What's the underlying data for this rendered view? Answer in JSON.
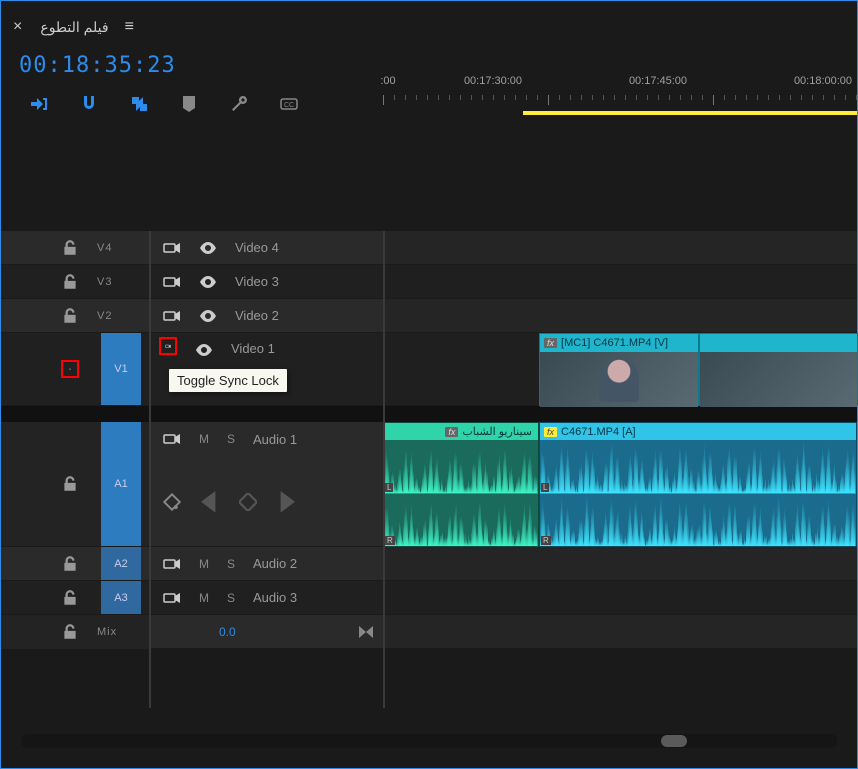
{
  "header": {
    "close": "×",
    "title": "فيلم التطوع",
    "menu": "≡"
  },
  "timecode": "00:18:35:23",
  "ruler": {
    "labels": [
      {
        "pos": 0,
        "text": ":00"
      },
      {
        "pos": 110,
        "text": "00:17:30:00"
      },
      {
        "pos": 275,
        "text": "00:17:45:00"
      },
      {
        "pos": 440,
        "text": "00:18:00:00"
      }
    ]
  },
  "tooltip": "Toggle Sync Lock",
  "tracks": {
    "video": [
      {
        "id": "V4",
        "name": "Video 4"
      },
      {
        "id": "V3",
        "name": "Video 3"
      },
      {
        "id": "V2",
        "name": "Video 2"
      },
      {
        "id": "V1",
        "name": "Video 1"
      }
    ],
    "audio": [
      {
        "id": "A1",
        "name": "Audio 1",
        "mute": "M",
        "solo": "S"
      },
      {
        "id": "A2",
        "name": "Audio 2",
        "mute": "M",
        "solo": "S"
      },
      {
        "id": "A3",
        "name": "Audio 3",
        "mute": "M",
        "solo": "S"
      }
    ],
    "mix": {
      "label": "Mix",
      "value": "0.0"
    }
  },
  "clips": {
    "v1": {
      "fx": "fx",
      "name": "[MC1] C4671.MP4 [V]"
    },
    "a1_left": {
      "fx": "fx",
      "name": "سيناريو الشباب",
      "chL": "L",
      "chR": "R"
    },
    "a1_right": {
      "fx": "fx",
      "name": "C4671.MP4 [A]",
      "chL": "L",
      "chR": "R"
    }
  }
}
